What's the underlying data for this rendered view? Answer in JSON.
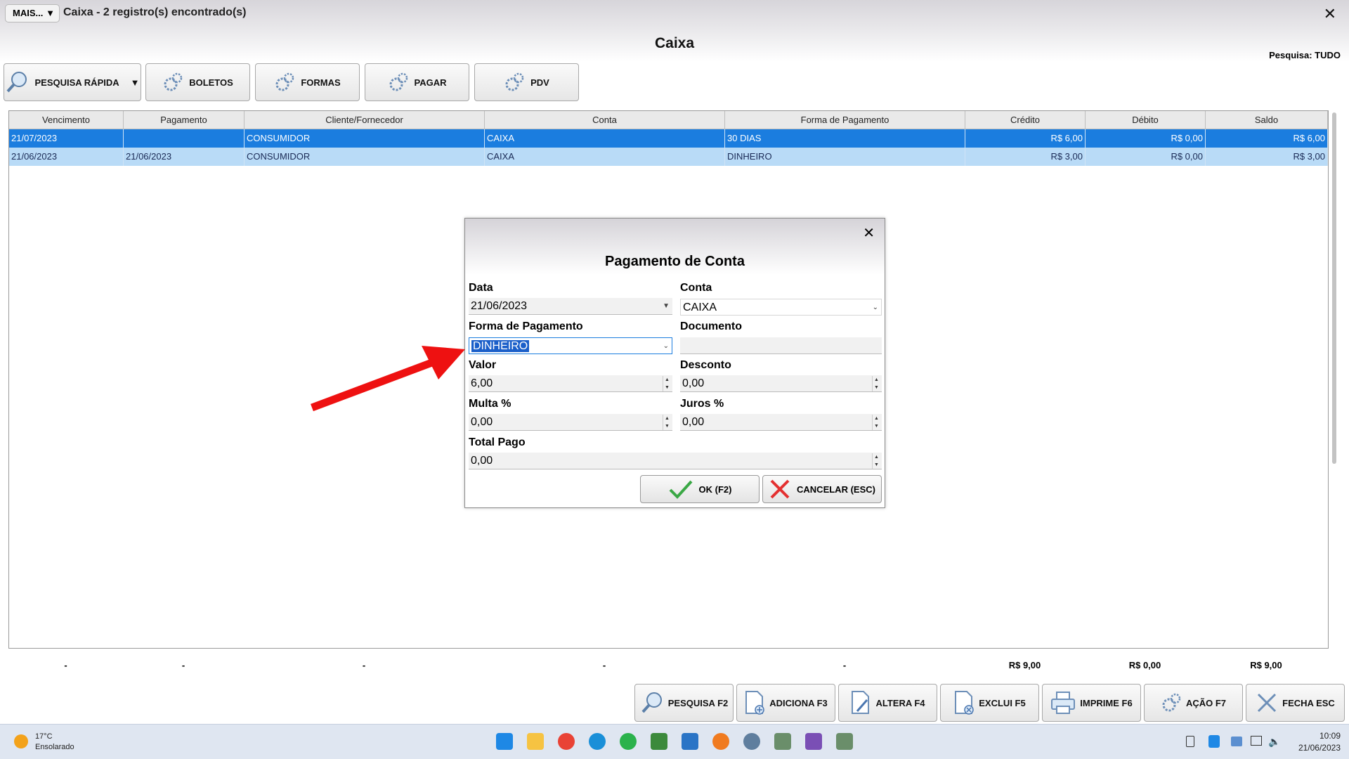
{
  "window": {
    "menu_label": "MAIS...",
    "title": "Caixa - 2 registro(s) encontrado(s)",
    "close_glyph": "✕"
  },
  "page": {
    "title": "Caixa",
    "search_scope_label": "Pesquisa: TUDO"
  },
  "toolbar": {
    "quick_search": "PESQUISA RÁPIDA",
    "boletos": "BOLETOS",
    "formas": "FORMAS",
    "pagar": "PAGAR",
    "pdv": "PDV"
  },
  "table": {
    "columns": [
      "Vencimento",
      "Pagamento",
      "Cliente/Fornecedor",
      "Conta",
      "Forma de Pagamento",
      "Crédito",
      "Débito",
      "Saldo"
    ],
    "rows": [
      {
        "vencimento": "21/07/2023",
        "pagamento": "",
        "cliente": "CONSUMIDOR",
        "conta": "CAIXA",
        "forma": "30 DIAS",
        "credito": "R$ 6,00",
        "debito": "R$ 0,00",
        "saldo": "R$ 6,00"
      },
      {
        "vencimento": "21/06/2023",
        "pagamento": "21/06/2023",
        "cliente": "CONSUMIDOR",
        "conta": "CAIXA",
        "forma": "DINHEIRO",
        "credito": "R$ 3,00",
        "debito": "R$ 0,00",
        "saldo": "R$ 3,00"
      }
    ]
  },
  "totals": {
    "placeholder": "-",
    "credito": "R$ 9,00",
    "debito": "R$ 0,00",
    "saldo": "R$ 9,00"
  },
  "dialog": {
    "title": "Pagamento de Conta",
    "close_glyph": "✕",
    "data_label": "Data",
    "data_value": "21/06/2023",
    "conta_label": "Conta",
    "conta_value": "CAIXA",
    "forma_label": "Forma de Pagamento",
    "forma_value": "DINHEIRO",
    "documento_label": "Documento",
    "documento_value": "",
    "valor_label": "Valor",
    "valor_value": "6,00",
    "desconto_label": "Desconto",
    "desconto_value": "0,00",
    "multa_label": "Multa %",
    "multa_value": "0,00",
    "juros_label": "Juros %",
    "juros_value": "0,00",
    "total_label": "Total Pago",
    "total_value": "0,00",
    "ok_label": "OK (F2)",
    "cancel_label": "CANCELAR (ESC)"
  },
  "bottom": {
    "pesquisa": "PESQUISA F2",
    "adiciona": "ADICIONA F3",
    "altera": "ALTERA F4",
    "exclui": "EXCLUI F5",
    "imprime": "IMPRIME F6",
    "acao": "AÇÃO F7",
    "fecha": "FECHA ESC"
  },
  "taskbar": {
    "weather_temp": "17°C",
    "weather_desc": "Ensolarado",
    "time": "10:09",
    "date": "21/06/2023"
  },
  "colors": {
    "selection": "#1b7ddf",
    "alt_row": "#b9dbf7",
    "annotation_arrow": "#ee1111"
  }
}
